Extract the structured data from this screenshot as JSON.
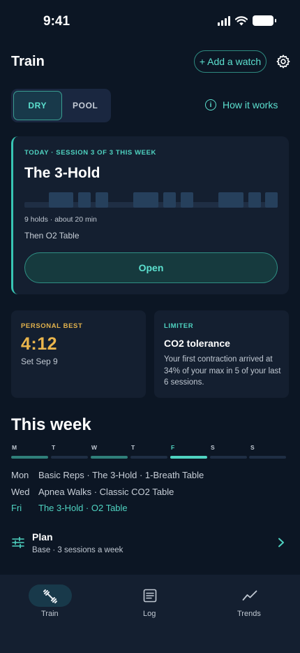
{
  "status_bar": {
    "time": "9:41"
  },
  "header": {
    "title": "Train",
    "add_watch_label": "+ Add a watch"
  },
  "mode_toggle": {
    "options": [
      "DRY",
      "POOL"
    ],
    "selected": "DRY"
  },
  "how_it_works_label": "How it works",
  "session": {
    "eyebrow": "TODAY · SESSION 3 OF 3 THIS WEEK",
    "title": "The 3-Hold",
    "meta": "9 holds · about 20 min",
    "then": "Then O2 Table",
    "open_label": "Open"
  },
  "personal_best": {
    "eyebrow": "PERSONAL BEST",
    "value": "4:12",
    "date": "Set Sep 9"
  },
  "limiter": {
    "eyebrow": "LIMITER",
    "title": "CO2 tolerance",
    "body": "Your first contraction arrived at 34% of your max in 5 of your last 6 sessions."
  },
  "this_week": {
    "title": "This week",
    "days": [
      {
        "letter": "M",
        "status": "done"
      },
      {
        "letter": "T",
        "status": "none"
      },
      {
        "letter": "W",
        "status": "done"
      },
      {
        "letter": "T",
        "status": "none"
      },
      {
        "letter": "F",
        "status": "today"
      },
      {
        "letter": "S",
        "status": "none"
      },
      {
        "letter": "S",
        "status": "none"
      }
    ],
    "rows": [
      {
        "day": "Mon",
        "sessions": "Basic Reps · The 3-Hold · 1-Breath Table"
      },
      {
        "day": "Wed",
        "sessions": "Apnea Walks · Classic CO2 Table"
      },
      {
        "day": "Fri",
        "sessions": "The 3-Hold · O2 Table"
      }
    ]
  },
  "plan": {
    "title": "Plan",
    "subtitle": "Base · 3 sessions a week"
  },
  "bottom_nav": {
    "items": [
      {
        "label": "Train",
        "icon": "dumbbell-icon",
        "active": true
      },
      {
        "label": "Log",
        "icon": "list-icon",
        "active": false
      },
      {
        "label": "Trends",
        "icon": "trend-line-icon",
        "active": false
      }
    ]
  },
  "colors": {
    "accent": "#4fd3c1",
    "gold": "#eab54c",
    "background": "#0c1624",
    "card": "#141f30"
  }
}
